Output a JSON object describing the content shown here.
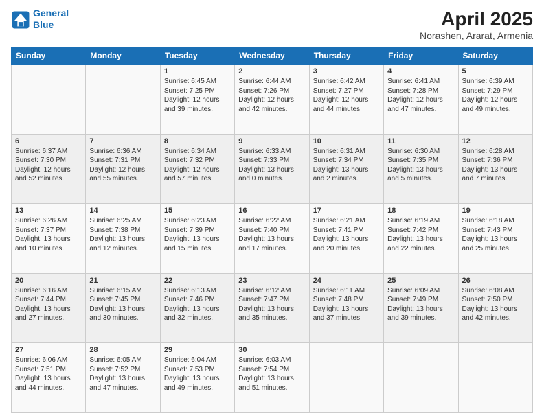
{
  "header": {
    "logo_line1": "General",
    "logo_line2": "Blue",
    "title": "April 2025",
    "subtitle": "Norashen, Ararat, Armenia"
  },
  "days_of_week": [
    "Sunday",
    "Monday",
    "Tuesday",
    "Wednesday",
    "Thursday",
    "Friday",
    "Saturday"
  ],
  "weeks": [
    [
      {
        "day": "",
        "sunrise": "",
        "sunset": "",
        "daylight": ""
      },
      {
        "day": "",
        "sunrise": "",
        "sunset": "",
        "daylight": ""
      },
      {
        "day": "1",
        "sunrise": "Sunrise: 6:45 AM",
        "sunset": "Sunset: 7:25 PM",
        "daylight": "Daylight: 12 hours and 39 minutes."
      },
      {
        "day": "2",
        "sunrise": "Sunrise: 6:44 AM",
        "sunset": "Sunset: 7:26 PM",
        "daylight": "Daylight: 12 hours and 42 minutes."
      },
      {
        "day": "3",
        "sunrise": "Sunrise: 6:42 AM",
        "sunset": "Sunset: 7:27 PM",
        "daylight": "Daylight: 12 hours and 44 minutes."
      },
      {
        "day": "4",
        "sunrise": "Sunrise: 6:41 AM",
        "sunset": "Sunset: 7:28 PM",
        "daylight": "Daylight: 12 hours and 47 minutes."
      },
      {
        "day": "5",
        "sunrise": "Sunrise: 6:39 AM",
        "sunset": "Sunset: 7:29 PM",
        "daylight": "Daylight: 12 hours and 49 minutes."
      }
    ],
    [
      {
        "day": "6",
        "sunrise": "Sunrise: 6:37 AM",
        "sunset": "Sunset: 7:30 PM",
        "daylight": "Daylight: 12 hours and 52 minutes."
      },
      {
        "day": "7",
        "sunrise": "Sunrise: 6:36 AM",
        "sunset": "Sunset: 7:31 PM",
        "daylight": "Daylight: 12 hours and 55 minutes."
      },
      {
        "day": "8",
        "sunrise": "Sunrise: 6:34 AM",
        "sunset": "Sunset: 7:32 PM",
        "daylight": "Daylight: 12 hours and 57 minutes."
      },
      {
        "day": "9",
        "sunrise": "Sunrise: 6:33 AM",
        "sunset": "Sunset: 7:33 PM",
        "daylight": "Daylight: 13 hours and 0 minutes."
      },
      {
        "day": "10",
        "sunrise": "Sunrise: 6:31 AM",
        "sunset": "Sunset: 7:34 PM",
        "daylight": "Daylight: 13 hours and 2 minutes."
      },
      {
        "day": "11",
        "sunrise": "Sunrise: 6:30 AM",
        "sunset": "Sunset: 7:35 PM",
        "daylight": "Daylight: 13 hours and 5 minutes."
      },
      {
        "day": "12",
        "sunrise": "Sunrise: 6:28 AM",
        "sunset": "Sunset: 7:36 PM",
        "daylight": "Daylight: 13 hours and 7 minutes."
      }
    ],
    [
      {
        "day": "13",
        "sunrise": "Sunrise: 6:26 AM",
        "sunset": "Sunset: 7:37 PM",
        "daylight": "Daylight: 13 hours and 10 minutes."
      },
      {
        "day": "14",
        "sunrise": "Sunrise: 6:25 AM",
        "sunset": "Sunset: 7:38 PM",
        "daylight": "Daylight: 13 hours and 12 minutes."
      },
      {
        "day": "15",
        "sunrise": "Sunrise: 6:23 AM",
        "sunset": "Sunset: 7:39 PM",
        "daylight": "Daylight: 13 hours and 15 minutes."
      },
      {
        "day": "16",
        "sunrise": "Sunrise: 6:22 AM",
        "sunset": "Sunset: 7:40 PM",
        "daylight": "Daylight: 13 hours and 17 minutes."
      },
      {
        "day": "17",
        "sunrise": "Sunrise: 6:21 AM",
        "sunset": "Sunset: 7:41 PM",
        "daylight": "Daylight: 13 hours and 20 minutes."
      },
      {
        "day": "18",
        "sunrise": "Sunrise: 6:19 AM",
        "sunset": "Sunset: 7:42 PM",
        "daylight": "Daylight: 13 hours and 22 minutes."
      },
      {
        "day": "19",
        "sunrise": "Sunrise: 6:18 AM",
        "sunset": "Sunset: 7:43 PM",
        "daylight": "Daylight: 13 hours and 25 minutes."
      }
    ],
    [
      {
        "day": "20",
        "sunrise": "Sunrise: 6:16 AM",
        "sunset": "Sunset: 7:44 PM",
        "daylight": "Daylight: 13 hours and 27 minutes."
      },
      {
        "day": "21",
        "sunrise": "Sunrise: 6:15 AM",
        "sunset": "Sunset: 7:45 PM",
        "daylight": "Daylight: 13 hours and 30 minutes."
      },
      {
        "day": "22",
        "sunrise": "Sunrise: 6:13 AM",
        "sunset": "Sunset: 7:46 PM",
        "daylight": "Daylight: 13 hours and 32 minutes."
      },
      {
        "day": "23",
        "sunrise": "Sunrise: 6:12 AM",
        "sunset": "Sunset: 7:47 PM",
        "daylight": "Daylight: 13 hours and 35 minutes."
      },
      {
        "day": "24",
        "sunrise": "Sunrise: 6:11 AM",
        "sunset": "Sunset: 7:48 PM",
        "daylight": "Daylight: 13 hours and 37 minutes."
      },
      {
        "day": "25",
        "sunrise": "Sunrise: 6:09 AM",
        "sunset": "Sunset: 7:49 PM",
        "daylight": "Daylight: 13 hours and 39 minutes."
      },
      {
        "day": "26",
        "sunrise": "Sunrise: 6:08 AM",
        "sunset": "Sunset: 7:50 PM",
        "daylight": "Daylight: 13 hours and 42 minutes."
      }
    ],
    [
      {
        "day": "27",
        "sunrise": "Sunrise: 6:06 AM",
        "sunset": "Sunset: 7:51 PM",
        "daylight": "Daylight: 13 hours and 44 minutes."
      },
      {
        "day": "28",
        "sunrise": "Sunrise: 6:05 AM",
        "sunset": "Sunset: 7:52 PM",
        "daylight": "Daylight: 13 hours and 47 minutes."
      },
      {
        "day": "29",
        "sunrise": "Sunrise: 6:04 AM",
        "sunset": "Sunset: 7:53 PM",
        "daylight": "Daylight: 13 hours and 49 minutes."
      },
      {
        "day": "30",
        "sunrise": "Sunrise: 6:03 AM",
        "sunset": "Sunset: 7:54 PM",
        "daylight": "Daylight: 13 hours and 51 minutes."
      },
      {
        "day": "",
        "sunrise": "",
        "sunset": "",
        "daylight": ""
      },
      {
        "day": "",
        "sunrise": "",
        "sunset": "",
        "daylight": ""
      },
      {
        "day": "",
        "sunrise": "",
        "sunset": "",
        "daylight": ""
      }
    ]
  ]
}
